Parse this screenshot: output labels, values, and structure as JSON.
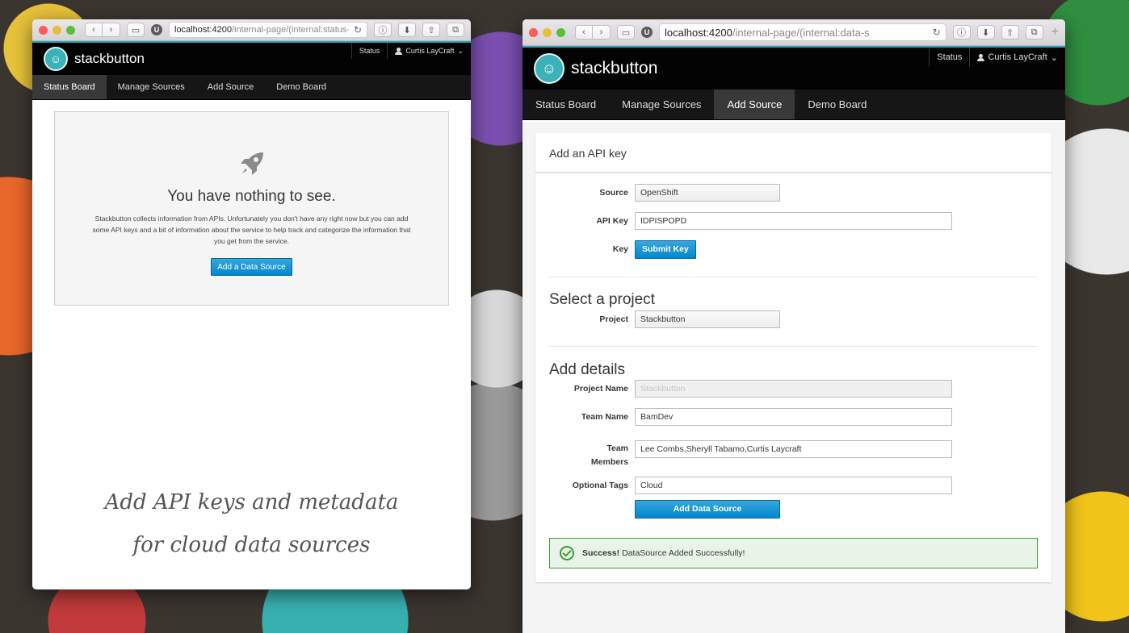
{
  "left_window": {
    "url_host": "localhost:4200",
    "url_path": "/internal-page/(internal:status-",
    "app": {
      "brand": "stackbutton",
      "status_link": "Status",
      "user_name": "Curtis LayCraft"
    },
    "nav": [
      {
        "label": "Status Board",
        "active": true
      },
      {
        "label": "Manage Sources",
        "active": false
      },
      {
        "label": "Add Source",
        "active": false
      },
      {
        "label": "Demo Board",
        "active": false
      }
    ],
    "empty_state": {
      "icon": "rocket-icon",
      "title": "You have nothing to see.",
      "body": "Stackbutton collects information from APIs. Unfortunately you don't have any right now but you can add some API keys and a bit of information about the service to help track and categorize the information that you get from the service.",
      "button": "Add a Data Source"
    }
  },
  "caption": {
    "line1": "Add API keys and metadata",
    "line2": "for cloud data sources"
  },
  "right_window": {
    "url_host": "localhost:4200",
    "url_path": "/internal-page/(internal:data-s",
    "app": {
      "brand": "stackbutton",
      "status_link": "Status",
      "user_name": "Curtis LayCraft"
    },
    "nav": [
      {
        "label": "Status Board",
        "active": false
      },
      {
        "label": "Manage Sources",
        "active": false
      },
      {
        "label": "Add Source",
        "active": true
      },
      {
        "label": "Demo Board",
        "active": false
      }
    ],
    "form": {
      "heading": "Add an API key",
      "source_label": "Source",
      "source_value": "OpenShift",
      "api_key_label": "API Key",
      "api_key_value": "IDPISPOPD",
      "key_label": "Key",
      "submit_key": "Submit Key",
      "project_section": "Select a project",
      "project_label": "Project",
      "project_value": "Stackbutton",
      "details_section": "Add details",
      "project_name_label": "Project Name",
      "project_name_placeholder": "Stackbutton",
      "team_name_label": "Team Name",
      "team_name_value": "BamDev",
      "team_members_label_1": "Team",
      "team_members_label_2": "Members",
      "team_members_value": "Lee Combs,Sheryll Tabamo,Curtis Laycraft",
      "tags_label": "Optional Tags",
      "tags_value": "Cloud",
      "add_button": "Add Data Source"
    },
    "alert": {
      "strong": "Success!",
      "message": "DataSource Added Successfully!",
      "color": "#3f9c35"
    }
  }
}
